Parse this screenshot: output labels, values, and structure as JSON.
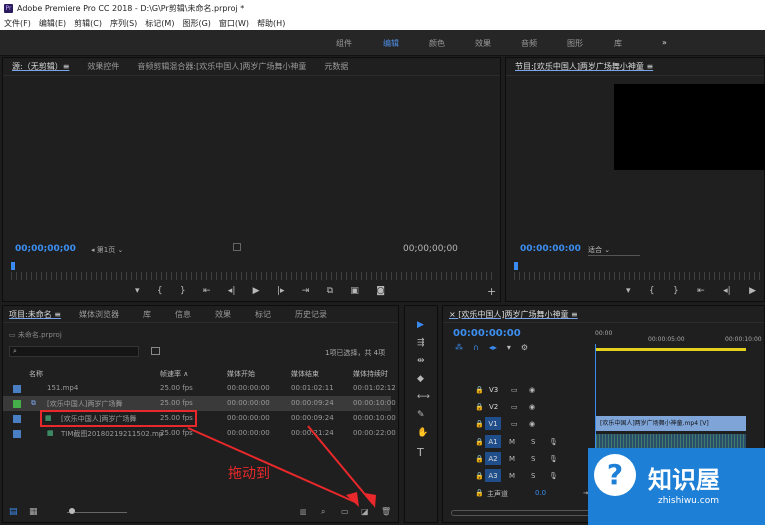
{
  "window": {
    "title": "Adobe Premiere Pro CC 2018 - D:\\G\\Pr剪辑\\未命名.prproj *"
  },
  "menu": [
    "文件(F)",
    "编辑(E)",
    "剪辑(C)",
    "序列(S)",
    "标记(M)",
    "图形(G)",
    "窗口(W)",
    "帮助(H)"
  ],
  "workspaces": [
    "组件",
    "编辑",
    "颜色",
    "效果",
    "音频",
    "图形",
    "库",
    "»"
  ],
  "source_panel": {
    "tabs": [
      "源:（无剪辑）≡",
      "效果控件",
      "音频剪辑混合器:[欢乐中国人]两岁广场舞小神童",
      "元数据"
    ],
    "timecode_left": "00;00;00;00",
    "page": "第1页",
    "timecode_right": "00;00;00;00"
  },
  "program_panel": {
    "tab": "节目:[欢乐中国人]两岁广场舞小神童 ≡",
    "timecode": "00:00:00:00",
    "fit": "适合"
  },
  "project_panel": {
    "tabs": [
      "项目:未命名 ≡",
      "媒体浏览器",
      "库",
      "信息",
      "效果",
      "标记",
      "历史记录"
    ],
    "project_file": "未命名.prproj",
    "selection_status": "1项已选择，共 4项",
    "columns": [
      "名称",
      "帧速率 ∧",
      "媒体开始",
      "媒体结束",
      "媒体持续时"
    ],
    "rows": [
      {
        "color": "#4a7fc4",
        "name": "151.mp4",
        "fps": "25.00 fps",
        "start": "00:00:00:00",
        "end": "00:01:02:11",
        "dur": "00:01:02:12"
      },
      {
        "color": "#45b04a",
        "name": "[欢乐中国人]两岁广场舞",
        "fps": "25.00 fps",
        "start": "00:00:00:00",
        "end": "00:00:09:24",
        "dur": "00:00:10:00"
      },
      {
        "color": "#4a7fc4",
        "name": "[欢乐中国人]两岁广场舞",
        "fps": "25.00 fps",
        "start": "00:00:00:00",
        "end": "00:00:09:24",
        "dur": "00:00:10:00"
      },
      {
        "color": "#4a7fc4",
        "name": "TIM截图20180219211502.mp",
        "fps": "25.00 fps",
        "start": "00:00:00:00",
        "end": "00:00:21:24",
        "dur": "00:00:22:00"
      }
    ]
  },
  "annotation": {
    "text": "拖动到",
    "color": "#e8282a"
  },
  "timeline": {
    "tab": "[欢乐中国人]两岁广场舞小神童",
    "timecode": "00:00:00:00",
    "ruler": [
      "00:00",
      "00:00:05:00",
      "00:00:10:00"
    ],
    "video_tracks": [
      "V3",
      "V2",
      "V1"
    ],
    "audio_tracks": [
      "A1",
      "A2",
      "A3"
    ],
    "master": "主声道",
    "master_value": "0.0",
    "clip_label": "[欢乐中国人]两岁广场舞小神童.mp4 [V]"
  },
  "watermark": {
    "brand": "知识屋",
    "url": "zhishiwu.com"
  }
}
